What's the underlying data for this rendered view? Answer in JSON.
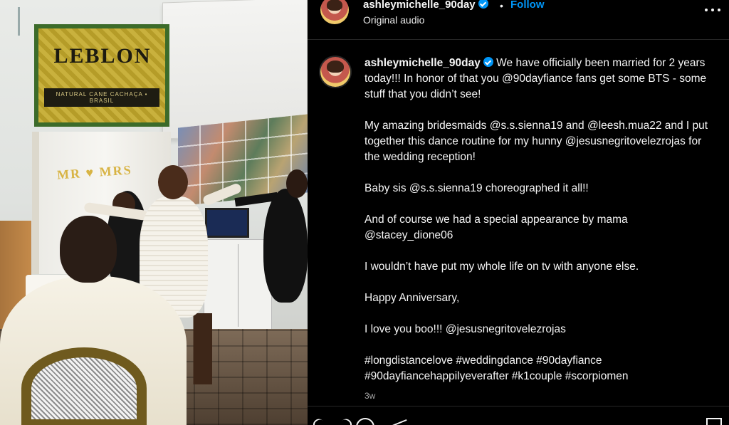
{
  "media": {
    "sign_title": "LEBLON",
    "sign_subtitle": "NATURAL CANE CACHAÇA • BRASIL",
    "banner_text": "MR ♥ MRS"
  },
  "header": {
    "username": "ashleymichelle_90day",
    "verified": true,
    "separator": "•",
    "follow_label": "Follow",
    "audio_label": "Original audio",
    "more_icon": "more-horizontal-icon"
  },
  "caption": {
    "username": "ashleymichelle_90day",
    "verified": true,
    "paragraphs": [
      "We have officially been married for 2 years today!!! In honor of that you @90dayfiance fans get some BTS - some stuff that you didn’t see!",
      "My amazing bridesmaids @s.s.sienna19 and @leesh.mua22 and I put together this dance routine for my hunny @jesusnegritovelezrojas for the wedding reception!",
      "Baby sis @s.s.sienna19 choreographed it all!!",
      "And of course we had a special appearance by mama @stacey_dione06",
      "I wouldn’t have put my whole life on tv with anyone else.",
      "Happy Anniversary,",
      "I love you boo!!! @jesusnegritovelezrojas",
      "#longdistancelove #weddingdance #90dayfiance #90dayfiancehappilyeverafter #k1couple #scorpiomen"
    ],
    "time_ago": "3w"
  },
  "actions": {
    "icons": [
      "heart-icon",
      "comment-icon",
      "share-icon",
      "bookmark-icon"
    ]
  },
  "colors": {
    "background": "#000000",
    "text": "#f5f5f5",
    "link_blue": "#0095f6",
    "secondary_text": "#a8a8a8",
    "divider": "#262626"
  }
}
